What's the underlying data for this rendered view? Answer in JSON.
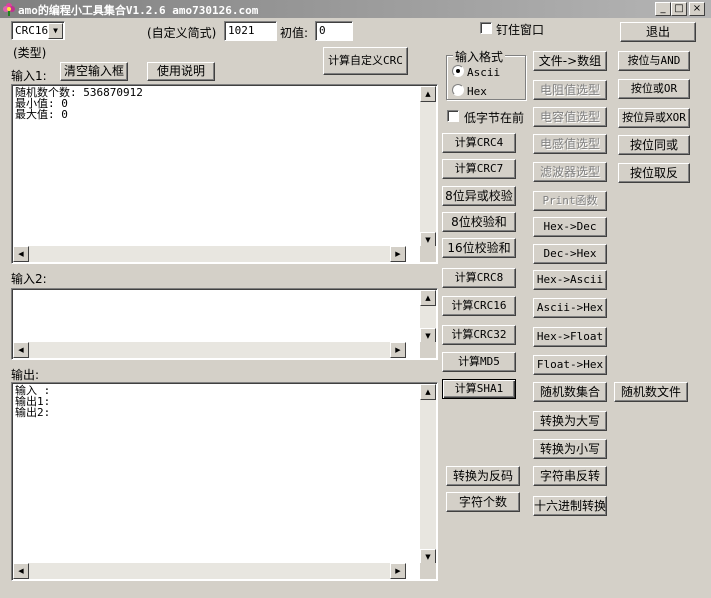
{
  "window": {
    "title": "amo的编程小工具集合V1.2.6 amo730126.com",
    "minimize_glyph": "_",
    "maximize_glyph": "□",
    "close_glyph": "×"
  },
  "top": {
    "crc_select": "CRC16",
    "custom_label": "(自定义简式)",
    "custom_value": "1021",
    "init_label": "初值:",
    "init_value": "0",
    "pin_label": "钉住窗口",
    "exit_label": "退出",
    "type_label": "(类型)",
    "calc_custom_crc_label": "计算自定义CRC"
  },
  "input1": {
    "label": "输入1:",
    "clear_label": "清空输入框",
    "help_label": "使用说明",
    "content": "随机数个数: 536870912\n最小值: 0\n最大值: 0"
  },
  "input2": {
    "label": "输入2:",
    "content": ""
  },
  "output": {
    "label": "输出:",
    "content": "输入 :\n输出1:\n输出2:"
  },
  "input_format": {
    "legend": "输入格式",
    "options": [
      "Ascii",
      "Hex"
    ],
    "selected": "Ascii"
  },
  "low_byte_first_label": "低字节在前",
  "col1_buttons": [
    "计算CRC4",
    "计算CRC7",
    "8位异或校验",
    "8位校验和",
    "16位校验和",
    "计算CRC8",
    "计算CRC16",
    "计算CRC32",
    "计算MD5",
    "计算SHA1"
  ],
  "col2_buttons": [
    "文件->数组",
    "电阻值选型",
    "电容值选型",
    "电感值选型",
    "滤波器选型",
    "Print函数",
    "Hex->Dec",
    "Dec->Hex",
    "Hex->Ascii",
    "Ascii->Hex",
    "Hex->Float",
    "Float->Hex",
    "随机数集合",
    "转换为大写",
    "转换为小写",
    "字符串反转",
    "十六进制转换"
  ],
  "col3_buttons": [
    "按位与AND",
    "按位或OR",
    "按位异或XOR",
    "按位同或",
    "按位取反",
    "随机数文件"
  ],
  "misc_buttons": {
    "reverse_code": "转换为反码",
    "char_count": "字符个数"
  },
  "scroll_glyphs": {
    "up": "▲",
    "down": "▼",
    "left": "◀",
    "right": "▶"
  }
}
